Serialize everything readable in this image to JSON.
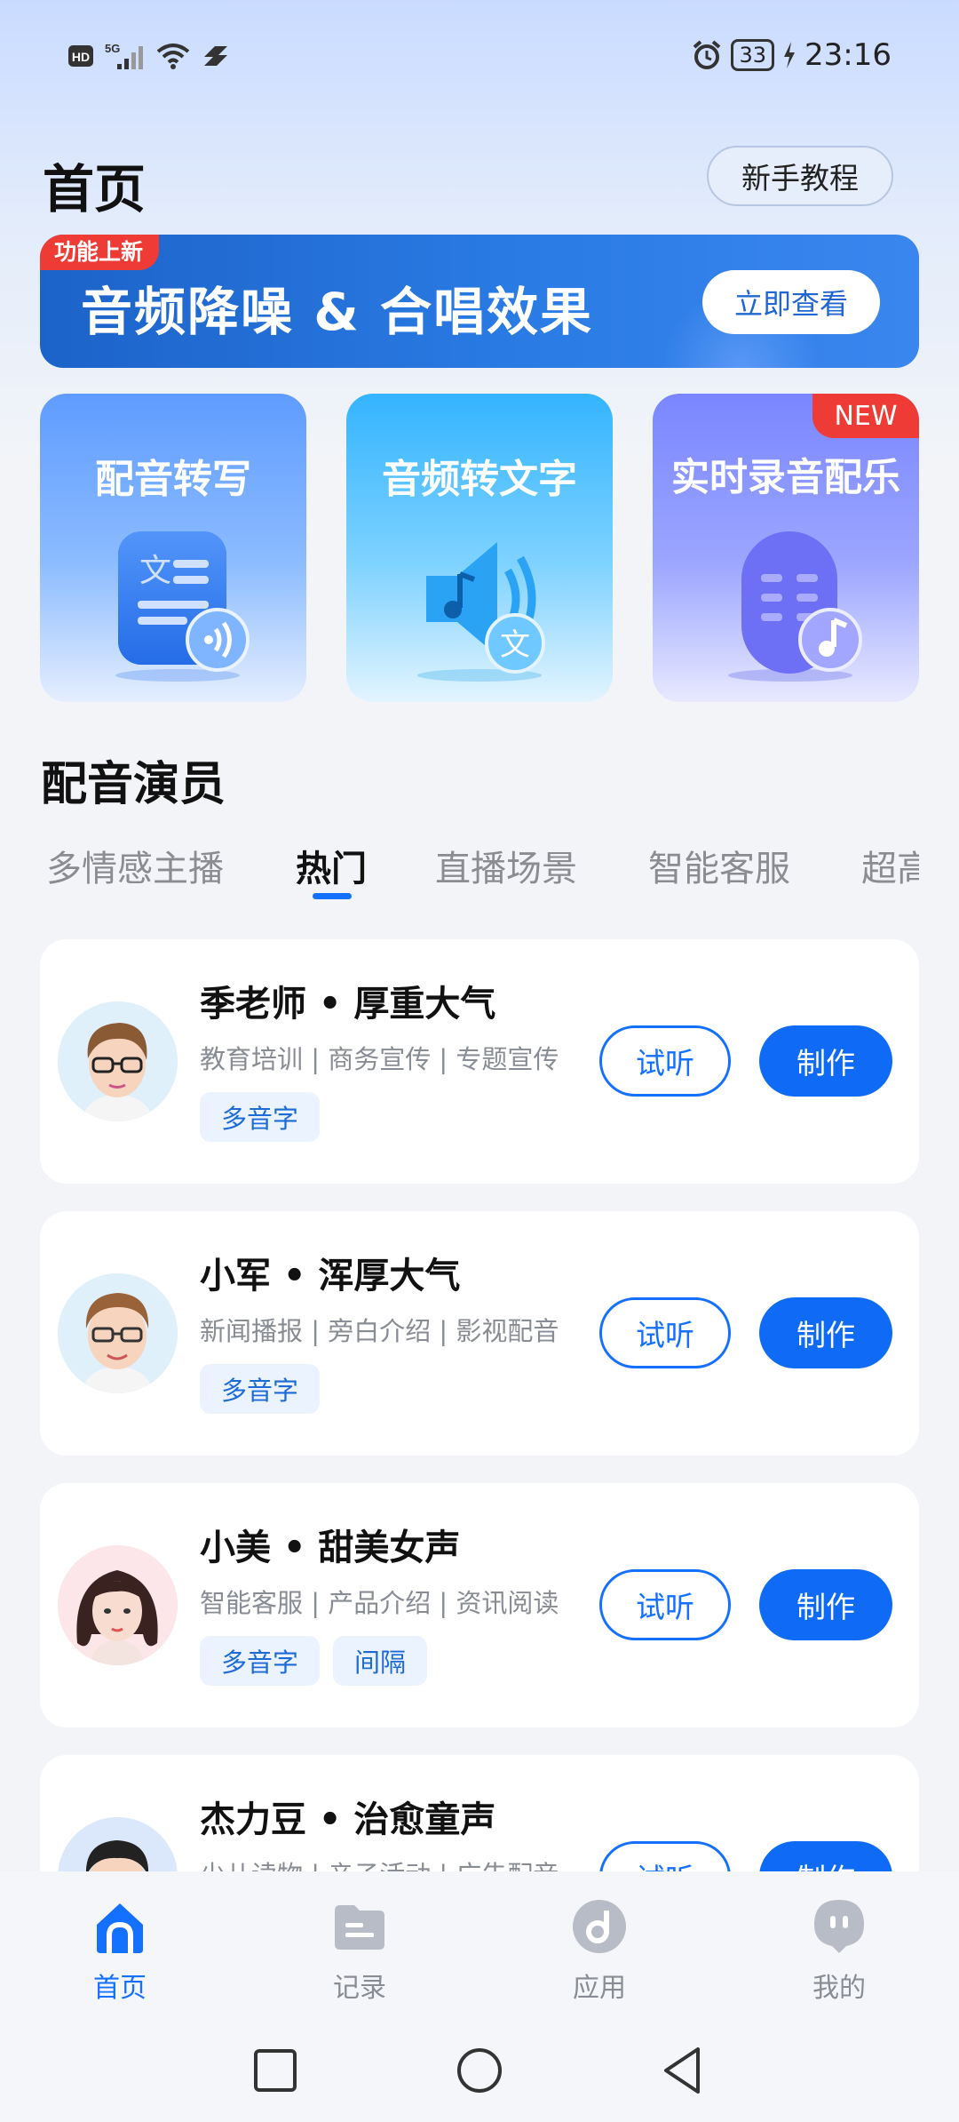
{
  "status_bar": {
    "left_icons": [
      "hd-icon",
      "5g-signal-icon",
      "wifi-icon",
      "link-icon"
    ],
    "battery": "33",
    "time": "23:16"
  },
  "header": {
    "title": "首页",
    "tutorial_button": "新手教程"
  },
  "banner": {
    "badge": "功能上新",
    "title": "音频降噪 & 合唱效果",
    "button": "立即查看"
  },
  "features": [
    {
      "title": "配音转写",
      "icon": "document-audio-icon",
      "badge": ""
    },
    {
      "title": "音频转文字",
      "icon": "speaker-text-icon",
      "badge": ""
    },
    {
      "title": "实时录音配乐",
      "icon": "microphone-music-icon",
      "badge": "NEW"
    }
  ],
  "section": {
    "title": "配音演员",
    "tabs": [
      "多情感主播",
      "热门",
      "直播场景",
      "智能客服",
      "超高"
    ],
    "active_tab": "热门"
  },
  "actors": [
    {
      "name": "季老师 • 厚重大气",
      "tags": "教育培训 | 商务宣传 | 专题宣传",
      "chips": [
        "多音字"
      ],
      "listen": "试听",
      "make": "制作"
    },
    {
      "name": "小军 • 浑厚大气",
      "tags": "新闻播报 | 旁白介绍 | 影视配音",
      "chips": [
        "多音字"
      ],
      "listen": "试听",
      "make": "制作"
    },
    {
      "name": "小美 • 甜美女声",
      "tags": "智能客服 | 产品介绍 | 资讯阅读",
      "chips": [
        "多音字",
        "间隔"
      ],
      "listen": "试听",
      "make": "制作"
    },
    {
      "name": "杰力豆 • 治愈童声",
      "tags": "少儿读物 | 亲子活动 | 广告配音",
      "chips": [],
      "listen": "试听",
      "make": "制作"
    }
  ],
  "bottom_nav": [
    {
      "label": "首页",
      "icon": "home-icon",
      "active": true
    },
    {
      "label": "记录",
      "icon": "folder-icon",
      "active": false
    },
    {
      "label": "应用",
      "icon": "app-icon",
      "active": false
    },
    {
      "label": "我的",
      "icon": "profile-icon",
      "active": false
    }
  ],
  "colors": {
    "accent": "#1470ff",
    "badge_red": "#ee3b35",
    "banner_blue": "#1c63c9"
  }
}
